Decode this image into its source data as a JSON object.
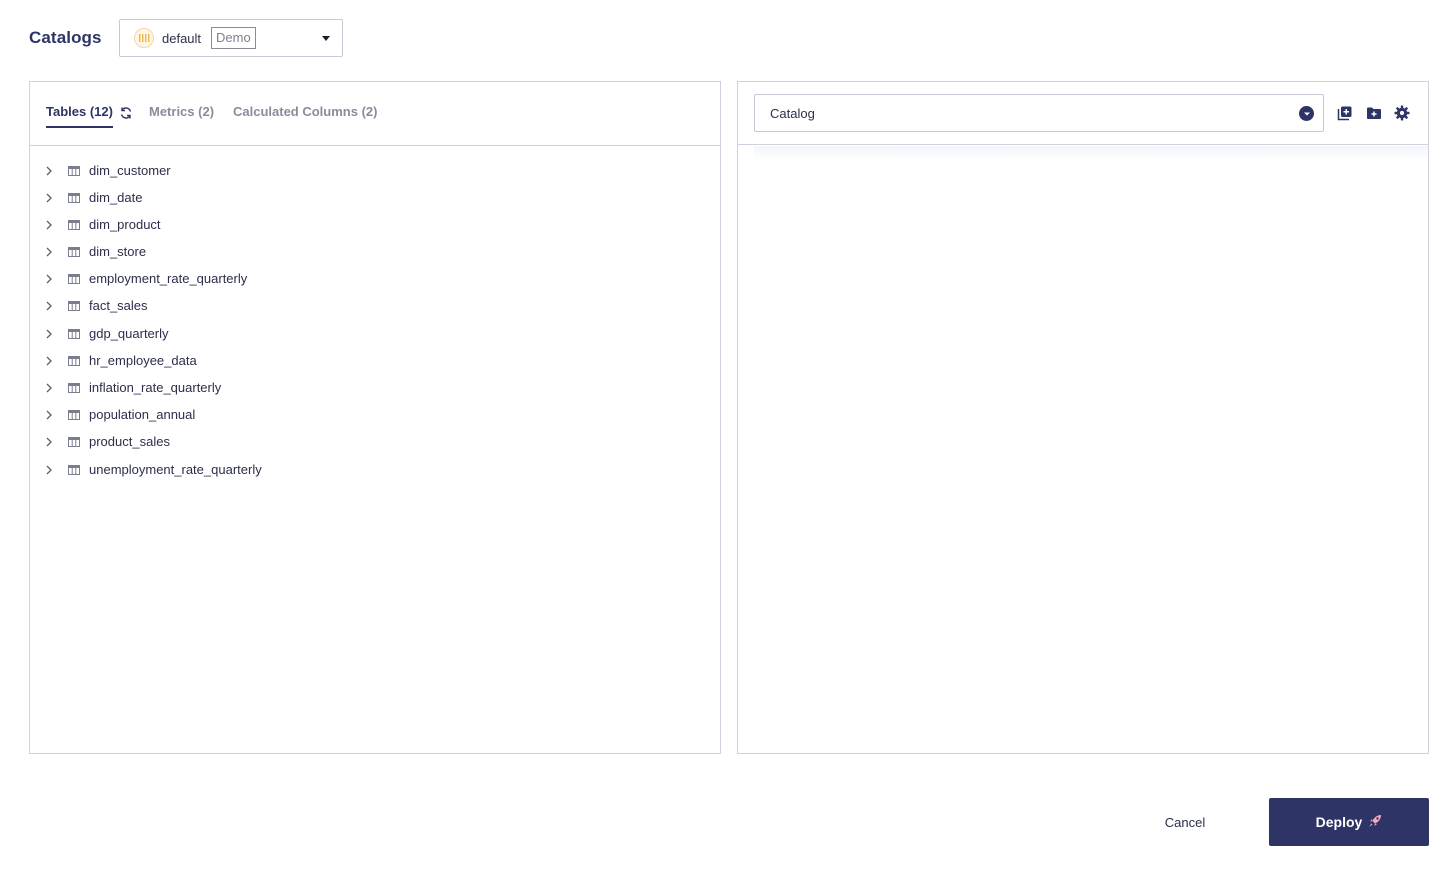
{
  "header": {
    "title": "Catalogs",
    "selected_catalog": "default",
    "environment_badge": "Demo"
  },
  "left_panel": {
    "tabs": [
      {
        "label": "Tables (12)",
        "active": true
      },
      {
        "label": "Metrics (2)",
        "active": false
      },
      {
        "label": "Calculated Columns (2)",
        "active": false
      }
    ],
    "tables": [
      "dim_customer",
      "dim_date",
      "dim_product",
      "dim_store",
      "employment_rate_quarterly",
      "fact_sales",
      "gdp_quarterly",
      "hr_employee_data",
      "inflation_rate_quarterly",
      "population_annual",
      "product_sales",
      "unemployment_rate_quarterly"
    ]
  },
  "right_panel": {
    "dropdown_label": "Catalog",
    "toolbar_icons": [
      "add-table-icon",
      "add-folder-icon",
      "settings-icon"
    ]
  },
  "footer": {
    "cancel_label": "Cancel",
    "deploy_label": "Deploy",
    "deploy_icon": "rocket-icon"
  },
  "colors": {
    "primary": "#2e3566",
    "border": "#cfd1df",
    "muted_text": "#8a8c9c"
  }
}
